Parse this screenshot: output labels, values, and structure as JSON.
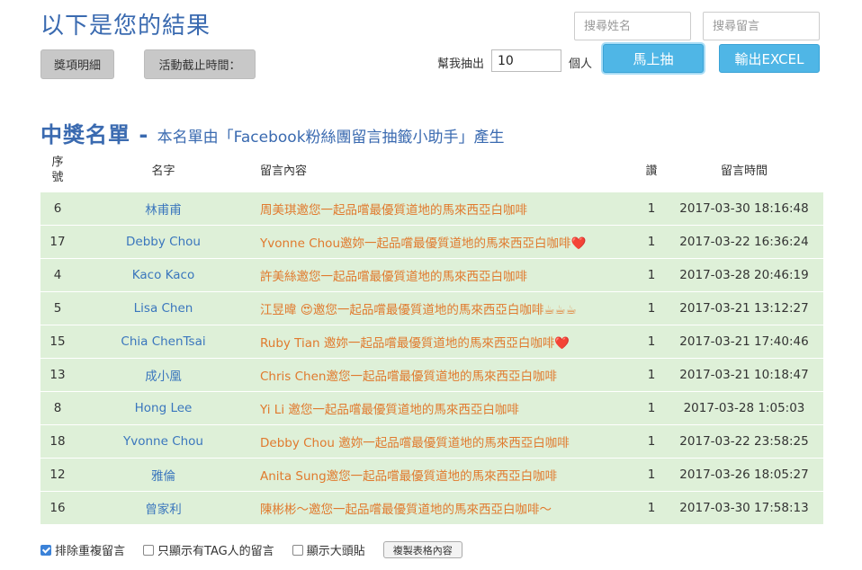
{
  "header": {
    "title": "以下是您的結果",
    "search_name_placeholder": "搜尋姓名",
    "search_comment_placeholder": "搜尋留言",
    "prize_details_label": "獎項明細",
    "deadline_label": "活動截止時間：",
    "draw_prefix": "幫我抽出",
    "draw_count": "10",
    "draw_unit": "個人",
    "draw_button": "馬上抽",
    "export_button": "輸出EXCEL"
  },
  "winners": {
    "heading": "中獎名單 - ",
    "subheading": "本名單由「Facebook粉絲團留言抽籤小助手」產生",
    "columns": {
      "seq": "序號",
      "name": "名字",
      "comment": "留言內容",
      "likes": "讚",
      "time": "留言時間"
    },
    "rows": [
      {
        "seq": "6",
        "name": "林甫甫",
        "comment": "周美琪邀您一起品嚐最優質道地的馬來西亞白咖啡",
        "likes": "1",
        "time": "2017-03-30 18:16:48"
      },
      {
        "seq": "17",
        "name": "Debby Chou",
        "comment": "Yvonne Chou邀妳一起品嚐最優質道地的馬來西亞白咖啡❤️",
        "likes": "1",
        "time": "2017-03-22 16:36:24"
      },
      {
        "seq": "4",
        "name": "Kaco Kaco",
        "comment": "許美絲邀您一起品嚐最優質道地的馬來西亞白咖啡",
        "likes": "1",
        "time": "2017-03-28 20:46:19"
      },
      {
        "seq": "5",
        "name": "Lisa Chen",
        "comment": "江昱暐 😍邀您一起品嚐最優質道地的馬來西亞白咖啡☕☕☕",
        "likes": "1",
        "time": "2017-03-21 13:12:27"
      },
      {
        "seq": "15",
        "name": "Chia ChenTsai",
        "comment": "Ruby Tian 邀妳一起品嚐最優質道地的馬來西亞白咖啡❤️",
        "likes": "1",
        "time": "2017-03-21 17:40:46"
      },
      {
        "seq": "13",
        "name": "成小凰",
        "comment": "Chris Chen邀您一起品嚐最優質道地的馬來西亞白咖啡",
        "likes": "1",
        "time": "2017-03-21 10:18:47"
      },
      {
        "seq": "8",
        "name": "Hong Lee",
        "comment": "Yi Li 邀您一起品嚐最優質道地的馬來西亞白咖啡",
        "likes": "1",
        "time": "2017-03-28 1:05:03"
      },
      {
        "seq": "18",
        "name": "Yvonne Chou",
        "comment": "Debby Chou 邀妳一起品嚐最優質道地的馬來西亞白咖啡",
        "likes": "1",
        "time": "2017-03-22 23:58:25"
      },
      {
        "seq": "12",
        "name": "雅倫",
        "comment": "Anita Sung邀您一起品嚐最優質道地的馬來西亞白咖啡",
        "likes": "1",
        "time": "2017-03-26 18:05:27"
      },
      {
        "seq": "16",
        "name": "曾家利",
        "comment": "陳彬彬～邀您一起品嚐最優質道地的馬來西亞白咖啡～",
        "likes": "1",
        "time": "2017-03-30 17:58:13"
      }
    ]
  },
  "options": {
    "exclude_duplicates": {
      "label": "排除重複留言",
      "checked": true
    },
    "only_tagged": {
      "label": "只顯示有TAG人的留言",
      "checked": false
    },
    "show_avatars": {
      "label": "顯示大頭貼",
      "checked": false
    },
    "copy_table": "複製表格內容"
  }
}
